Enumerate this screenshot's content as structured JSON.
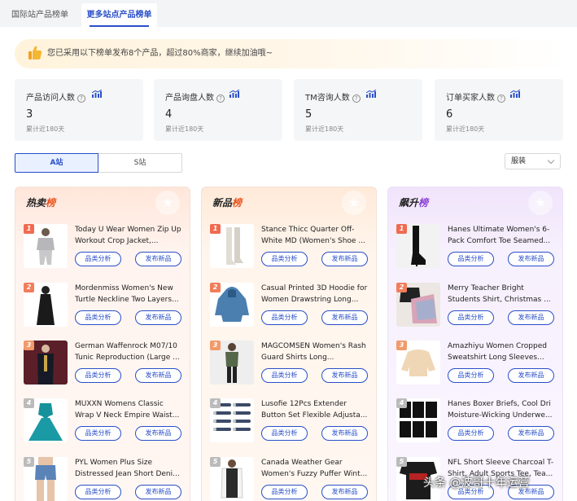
{
  "tabs": [
    {
      "label": "国际站产品榜单",
      "active": false
    },
    {
      "label": "更多站点产品榜单",
      "active": true
    }
  ],
  "banner": {
    "text": "您已采用以下榜单发布8个产品，超过80%商家，继续加油哦~",
    "icon": "thumbs-up-icon"
  },
  "stats": [
    {
      "label": "产品访问人数",
      "value": "3",
      "sub": "累计近180天"
    },
    {
      "label": "产品询盘人数",
      "value": "4",
      "sub": "累计近180天"
    },
    {
      "label": "TM咨询人数",
      "value": "5",
      "sub": "累计近180天"
    },
    {
      "label": "订单买家人数",
      "value": "6",
      "sub": "累计近180天"
    }
  ],
  "site_toggle": {
    "a": "A站",
    "s": "S站"
  },
  "category_select": {
    "value": "服装"
  },
  "columns": [
    {
      "title_a": "热卖",
      "title_b": "榜",
      "items": [
        {
          "rank": "1",
          "name": "Today U Wear Women Zip Up Workout Crop Jacket,...",
          "btn1": "品类分析",
          "btn2": "发布新品"
        },
        {
          "rank": "2",
          "name": "Mordenmiss Women's New Turtle Neckline Two Layers...",
          "btn1": "品类分析",
          "btn2": "发布新品"
        },
        {
          "rank": "3",
          "name": "German Waffenrock M07/10 Tunic Reproduction (Large ...",
          "btn1": "品类分析",
          "btn2": "发布新品"
        },
        {
          "rank": "4",
          "name": "MUXXN Womens Classic Wrap V Neck Empire Waist...",
          "btn1": "品类分析",
          "btn2": "发布新品"
        },
        {
          "rank": "5",
          "name": "PYL Women Plus Size Distressed Jean Short Deni...",
          "btn1": "品类分析",
          "btn2": "发布新品"
        }
      ]
    },
    {
      "title_a": "新品",
      "title_b": "榜",
      "items": [
        {
          "rank": "1",
          "name": "Stance Thicc Quarter Off-White MD (Women's Shoe ...",
          "btn1": "品类分析",
          "btn2": "发布新品"
        },
        {
          "rank": "2",
          "name": "Casual Printed 3D Hoodie for Women Drawstring Long...",
          "btn1": "品类分析",
          "btn2": "发布新品"
        },
        {
          "rank": "3",
          "name": "MAGCOMSEN Women's Rash Guard Shirts Long...",
          "btn1": "品类分析",
          "btn2": "发布新品"
        },
        {
          "rank": "4",
          "name": "Lusofie 12Pcs Extender Button Set Flexible Adjusta...",
          "btn1": "品类分析",
          "btn2": "发布新品"
        },
        {
          "rank": "5",
          "name": "Canada Weather Gear Women's Fuzzy Puffer Wint...",
          "btn1": "品类分析",
          "btn2": "发布新品"
        }
      ]
    },
    {
      "title_a": "飙升",
      "title_b": "榜",
      "items": [
        {
          "rank": "1",
          "name": "Hanes Ultimate Women's 6-Pack Comfort Toe Seamed...",
          "btn1": "品类分析",
          "btn2": "发布新品"
        },
        {
          "rank": "2",
          "name": "Merry Teacher Bright Students Shirt, Christmas ...",
          "btn1": "品类分析",
          "btn2": "发布新品"
        },
        {
          "rank": "3",
          "name": "Amazhiyu Women Cropped Sweatshirt Long Sleeves...",
          "btn1": "品类分析",
          "btn2": "发布新品"
        },
        {
          "rank": "4",
          "name": "Hanes Boxer Briefs, Cool Dri Moisture-Wicking Underwe...",
          "btn1": "品类分析",
          "btn2": "发布新品"
        },
        {
          "rank": "5",
          "name": "NFL Short Sleeve Charcoal T-Shirt, Adult Sports Tee, Tea...",
          "btn1": "品类分析",
          "btn2": "发布新品"
        }
      ]
    }
  ],
  "watermark": "头条 @波哥十年运营"
}
